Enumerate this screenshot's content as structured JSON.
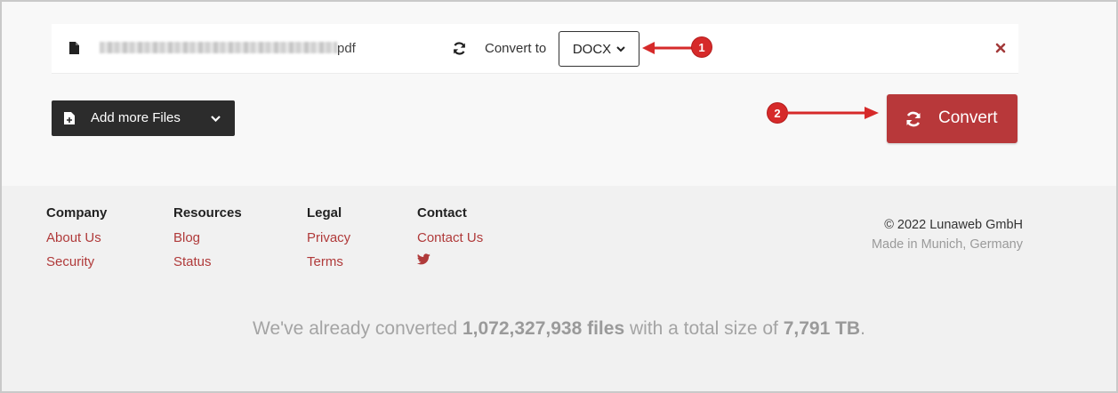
{
  "file": {
    "extension": "pdf",
    "convert_to_label": "Convert to",
    "selected_format": "DOCX"
  },
  "actions": {
    "add_more_label": "Add more Files",
    "convert_label": "Convert"
  },
  "annotations": {
    "badge_1": "1",
    "badge_2": "2"
  },
  "footer": {
    "company": {
      "heading": "Company",
      "links": [
        "About Us",
        "Security"
      ]
    },
    "resources": {
      "heading": "Resources",
      "links": [
        "Blog",
        "Status"
      ]
    },
    "legal": {
      "heading": "Legal",
      "links": [
        "Privacy",
        "Terms"
      ]
    },
    "contact": {
      "heading": "Contact",
      "links": [
        "Contact Us"
      ],
      "social_icon": "twitter-icon"
    },
    "copyright": "© 2022 Lunaweb GmbH",
    "made_in": "Made in Munich, Germany"
  },
  "stats": {
    "prefix": "We've already converted ",
    "files_count": "1,072,327,938 files",
    "middle": " with a total size of ",
    "total_size": "7,791 TB",
    "suffix": "."
  },
  "colors": {
    "accent": "#b8383a",
    "dark_button": "#2c2c2c",
    "link": "#b03a3a",
    "annotation": "#d62a2a"
  }
}
